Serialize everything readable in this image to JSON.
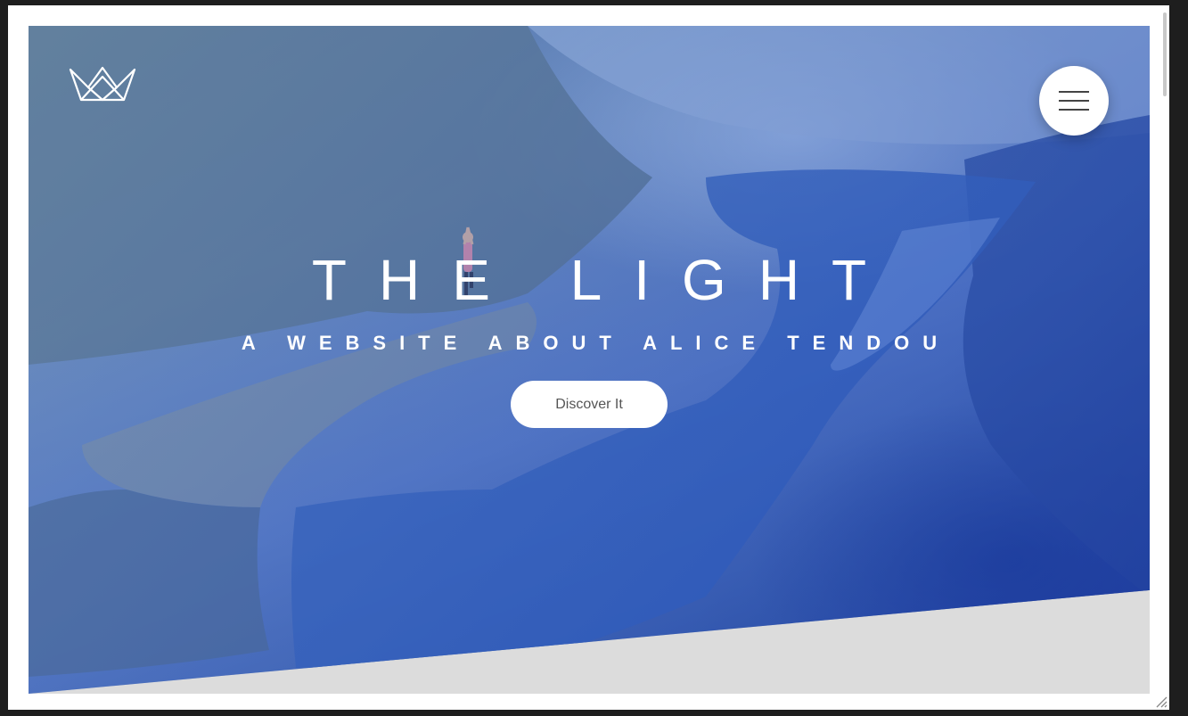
{
  "hero": {
    "title": "THE LIGHT",
    "subtitle": "A WEBSITE ABOUT ALICE TENDOU",
    "cta_label": "Discover It"
  },
  "header": {
    "logo_icon": "crown-logo-icon",
    "menu_icon": "hamburger-menu-icon"
  },
  "colors": {
    "overlay_blue": "#2f55b0",
    "page_gray": "#dcdcdc",
    "button_white": "#ffffff",
    "button_text": "#555555"
  }
}
